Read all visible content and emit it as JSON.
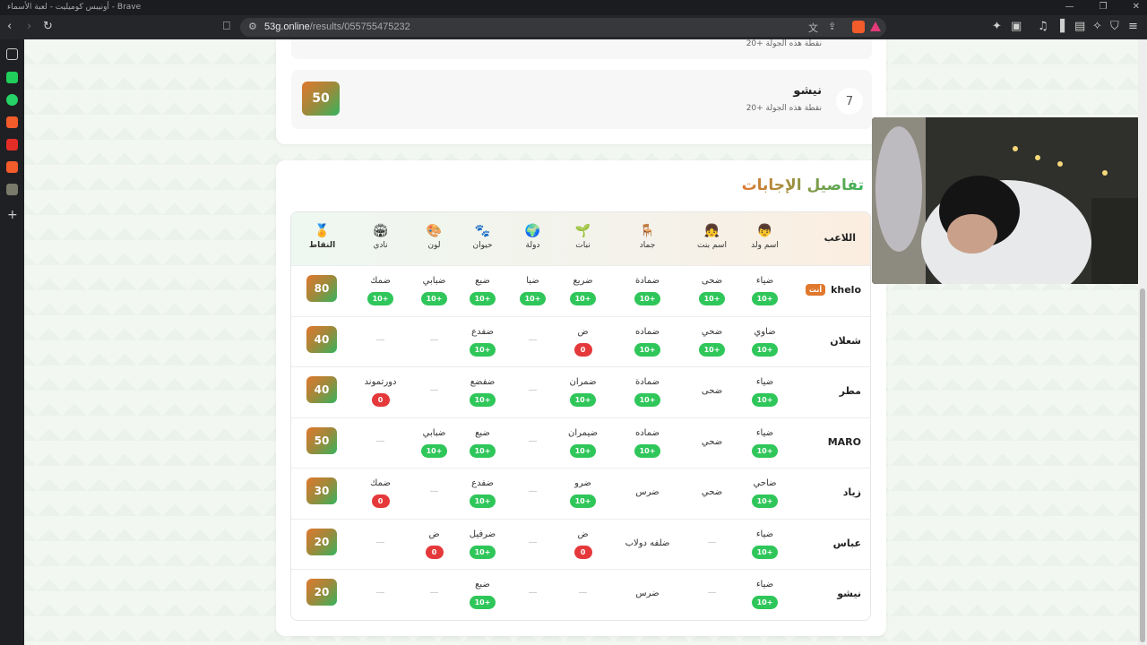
{
  "browser": {
    "window_title": "أونيبس كوميليت - لعبة الأسماء - Brave",
    "url_domain": "53g.online",
    "url_path": "/results/055755475232",
    "brave_shield_count": "1"
  },
  "top_rank": {
    "partial_sub": "20+ نقطة هذه الجولة",
    "row": {
      "rank": "7",
      "name": "نيشو",
      "sub": "20+ نقطة هذه الجولة",
      "score": "50"
    }
  },
  "details": {
    "title": "تفاصيل الإجابات",
    "header": {
      "player": "اللاعب",
      "columns": [
        {
          "label": "اسم ولد",
          "icon": "👦"
        },
        {
          "label": "اسم بنت",
          "icon": "👧"
        },
        {
          "label": "جماد",
          "icon": "🪑"
        },
        {
          "label": "نبات",
          "icon": "🌱"
        },
        {
          "label": "دولة",
          "icon": "🌍"
        },
        {
          "label": "حيوان",
          "icon": "🐾"
        },
        {
          "label": "لون",
          "icon": "🎨"
        },
        {
          "label": "نادي",
          "icon": "🏟"
        }
      ],
      "points": "النقاط",
      "points_icon": "🏅"
    },
    "you_label": "أنت",
    "rows": [
      {
        "name": "khelo",
        "is_you": true,
        "points": "80",
        "cells": [
          {
            "ans": "ضياء",
            "score": "10+",
            "kind": "g"
          },
          {
            "ans": "ضحى",
            "score": "10+",
            "kind": "g"
          },
          {
            "ans": "ضمادة",
            "score": "10+",
            "kind": "g"
          },
          {
            "ans": "ضريع",
            "score": "10+",
            "kind": "g"
          },
          {
            "ans": "ضبا",
            "score": "10+",
            "kind": "g"
          },
          {
            "ans": "ضبع",
            "score": "10+",
            "kind": "g"
          },
          {
            "ans": "ضبابي",
            "score": "10+",
            "kind": "g"
          },
          {
            "ans": "ضمك",
            "score": "10+",
            "kind": "g"
          }
        ]
      },
      {
        "name": "شعلان",
        "is_you": false,
        "points": "40",
        "cells": [
          {
            "ans": "ضاوي",
            "score": "10+",
            "kind": "g"
          },
          {
            "ans": "ضحي",
            "score": "10+",
            "kind": "g"
          },
          {
            "ans": "ضماده",
            "score": "10+",
            "kind": "g"
          },
          {
            "ans": "ض",
            "score": "0",
            "kind": "r"
          },
          {
            "ans": "—",
            "score": "",
            "kind": "dash"
          },
          {
            "ans": "ضفدع",
            "score": "10+",
            "kind": "g"
          },
          {
            "ans": "—",
            "score": "",
            "kind": "dash"
          },
          {
            "ans": "—",
            "score": "",
            "kind": "dash"
          }
        ]
      },
      {
        "name": "مطر",
        "is_you": false,
        "points": "40",
        "cells": [
          {
            "ans": "ضياء",
            "score": "10+",
            "kind": "g"
          },
          {
            "ans": "ضحى",
            "score": "",
            "kind": "plain"
          },
          {
            "ans": "ضمادة",
            "score": "10+",
            "kind": "g"
          },
          {
            "ans": "ضمران",
            "score": "10+",
            "kind": "g"
          },
          {
            "ans": "—",
            "score": "",
            "kind": "dash"
          },
          {
            "ans": "ضفضع",
            "score": "10+",
            "kind": "g"
          },
          {
            "ans": "—",
            "score": "",
            "kind": "dash"
          },
          {
            "ans": "دورتموند",
            "score": "0",
            "kind": "r"
          }
        ]
      },
      {
        "name": "MARO",
        "is_you": false,
        "points": "50",
        "cells": [
          {
            "ans": "ضياء",
            "score": "10+",
            "kind": "g"
          },
          {
            "ans": "ضحي",
            "score": "",
            "kind": "plain"
          },
          {
            "ans": "ضماده",
            "score": "10+",
            "kind": "g"
          },
          {
            "ans": "ضيمران",
            "score": "10+",
            "kind": "g"
          },
          {
            "ans": "—",
            "score": "",
            "kind": "dash"
          },
          {
            "ans": "ضبع",
            "score": "10+",
            "kind": "g"
          },
          {
            "ans": "ضبابي",
            "score": "10+",
            "kind": "g"
          },
          {
            "ans": "—",
            "score": "",
            "kind": "dash"
          }
        ]
      },
      {
        "name": "زياد",
        "is_you": false,
        "points": "30",
        "cells": [
          {
            "ans": "ضاحي",
            "score": "10+",
            "kind": "g"
          },
          {
            "ans": "ضحي",
            "score": "",
            "kind": "plain"
          },
          {
            "ans": "ضرس",
            "score": "",
            "kind": "plain"
          },
          {
            "ans": "ضرو",
            "score": "10+",
            "kind": "g"
          },
          {
            "ans": "—",
            "score": "",
            "kind": "dash"
          },
          {
            "ans": "ضفدع",
            "score": "10+",
            "kind": "g"
          },
          {
            "ans": "—",
            "score": "",
            "kind": "dash"
          },
          {
            "ans": "ضمك",
            "score": "0",
            "kind": "r"
          }
        ]
      },
      {
        "name": "عباس",
        "is_you": false,
        "points": "20",
        "cells": [
          {
            "ans": "ضياء",
            "score": "10+",
            "kind": "g"
          },
          {
            "ans": "—",
            "score": "",
            "kind": "dash"
          },
          {
            "ans": "ضلفه دولاب",
            "score": "",
            "kind": "plain"
          },
          {
            "ans": "ض",
            "score": "0",
            "kind": "r"
          },
          {
            "ans": "—",
            "score": "",
            "kind": "dash"
          },
          {
            "ans": "ضرفيل",
            "score": "10+",
            "kind": "g"
          },
          {
            "ans": "ض",
            "score": "0",
            "kind": "r"
          },
          {
            "ans": "—",
            "score": "",
            "kind": "dash"
          }
        ]
      },
      {
        "name": "نيشو",
        "is_you": false,
        "points": "20",
        "cells": [
          {
            "ans": "ضياء",
            "score": "10+",
            "kind": "g"
          },
          {
            "ans": "—",
            "score": "",
            "kind": "dash"
          },
          {
            "ans": "ضرس",
            "score": "",
            "kind": "plain"
          },
          {
            "ans": "—",
            "score": "",
            "kind": "dash"
          },
          {
            "ans": "—",
            "score": "",
            "kind": "dash"
          },
          {
            "ans": "ضبع",
            "score": "10+",
            "kind": "g"
          },
          {
            "ans": "—",
            "score": "",
            "kind": "dash"
          },
          {
            "ans": "—",
            "score": "",
            "kind": "dash"
          }
        ]
      }
    ]
  }
}
